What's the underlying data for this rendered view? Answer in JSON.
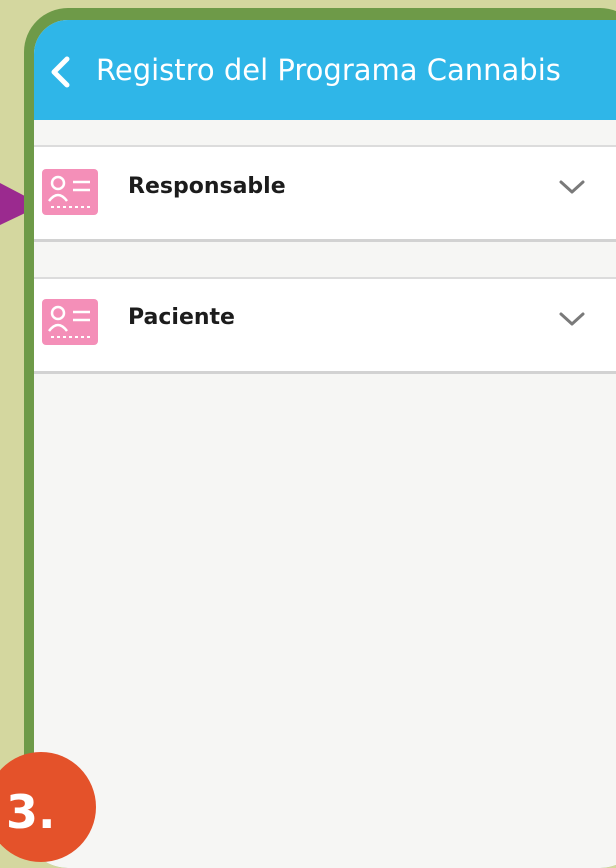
{
  "app_bar": {
    "title": "Registro del Programa Cannabis",
    "back_icon": "chevron-left-icon",
    "color": "#2fb6e8"
  },
  "sections": [
    {
      "label": "Responsable",
      "icon": "id-card-icon",
      "toggle_icon": "chevron-down-icon",
      "expanded": false
    },
    {
      "label": "Paciente",
      "icon": "id-card-icon",
      "toggle_icon": "chevron-down-icon",
      "expanded": false
    }
  ],
  "step_badge": {
    "text": "3.",
    "color": "#e4522a"
  },
  "colors": {
    "frame": "#6e9a48",
    "page_background": "#d4d79f",
    "pointer": "#9b2a8f",
    "icon_pink": "#f48fb8"
  }
}
